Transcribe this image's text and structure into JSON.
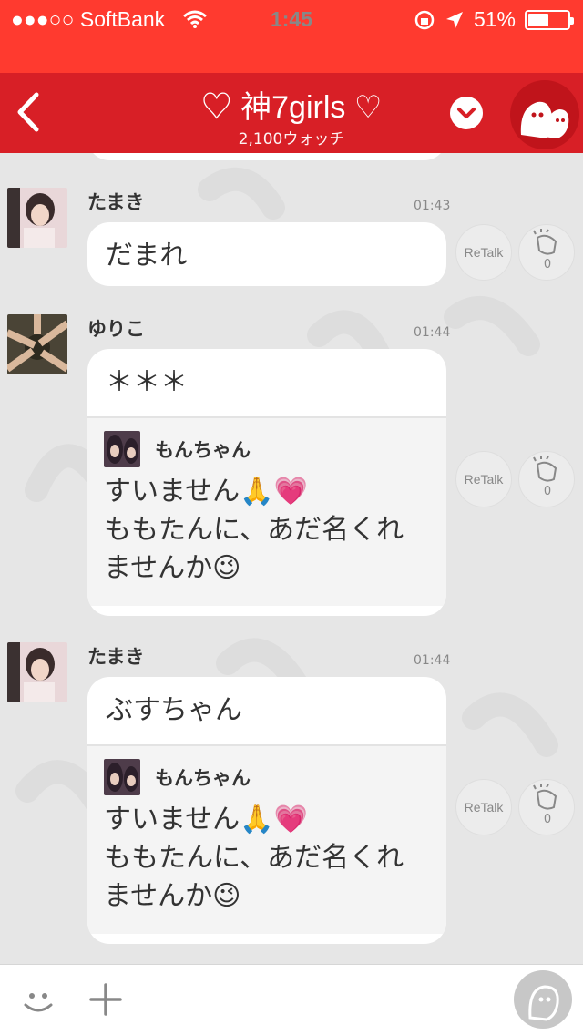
{
  "status": {
    "carrier": "●●●○○ SoftBank",
    "time": "1:45",
    "battery": "51%"
  },
  "header": {
    "title": "♡ 神7girls ♡",
    "watchers": "2,100ウォッチ"
  },
  "messages": [
    {
      "name": "たまき",
      "time": "01:43",
      "text": "だまれ",
      "retalk": "ReTalk",
      "claps": "0"
    },
    {
      "name": "ゆりこ",
      "time": "01:44",
      "text": "＊＊＊",
      "quote": {
        "name": "もんちゃん",
        "text": "すいません🙏💗\nももたんに、あだ名くれ\nませんか😉"
      },
      "retalk": "ReTalk",
      "claps": "0"
    },
    {
      "name": "たまき",
      "time": "01:44",
      "text": "ぶすちゃん",
      "quote": {
        "name": "もんちゃん",
        "text": "すいません🙏💗\nももたんに、あだ名くれ\nませんか😉"
      },
      "retalk": "ReTalk",
      "claps": "0"
    }
  ],
  "icons": {
    "back": "chevron-left-icon",
    "menu": "chevron-down-circle-icon",
    "profile": "ghost-avatar-icon",
    "emoji": "smile-icon",
    "attach": "plus-icon",
    "me": "user-avatar-icon"
  },
  "colors": {
    "status_bar": "#ff3a2f",
    "nav_bar": "#d81f26",
    "background": "#e6e6e6"
  }
}
